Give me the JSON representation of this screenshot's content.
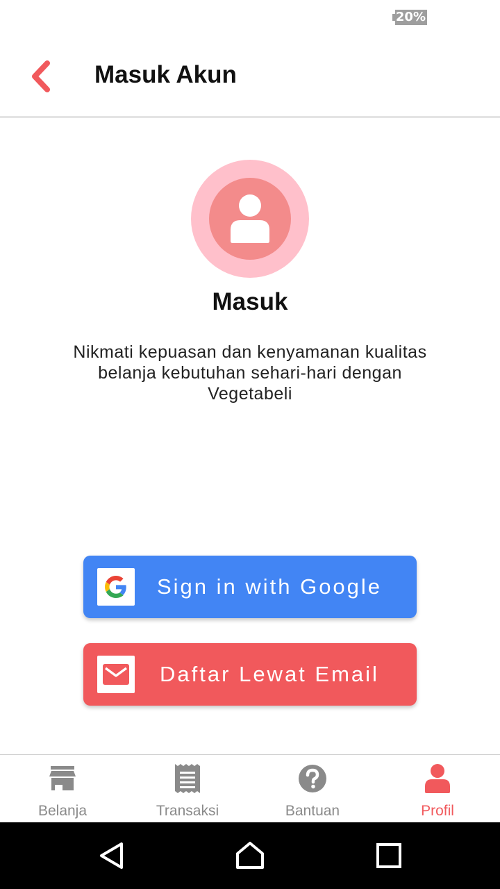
{
  "status_bar": {
    "battery": "20%"
  },
  "app_bar": {
    "title": "Masuk Akun",
    "back_icon": "chevron-left-icon"
  },
  "content": {
    "avatar_icon": "user-icon",
    "heading": "Masuk",
    "description": "Nikmati kepuasan dan kenyamanan kualitas belanja kebutuhan sehari-hari dengan Vegetabeli"
  },
  "buttons": {
    "google": {
      "label": "Sign in with Google",
      "icon": "google-icon",
      "color": "#4285f4"
    },
    "email": {
      "label": "Daftar Lewat Email",
      "icon": "mail-icon",
      "color": "#f1595c"
    }
  },
  "bottom_nav": {
    "items": [
      {
        "label": "Belanja",
        "icon": "store-icon"
      },
      {
        "label": "Transaksi",
        "icon": "receipt-icon"
      },
      {
        "label": "Bantuan",
        "icon": "help-icon"
      },
      {
        "label": "Profil",
        "icon": "person-icon",
        "active": true
      }
    ]
  },
  "colors": {
    "accent": "#f1595c",
    "avatar_outer": "#ffc0cb",
    "avatar_inner": "#f38b8b",
    "inactive": "#8a8a8a"
  }
}
